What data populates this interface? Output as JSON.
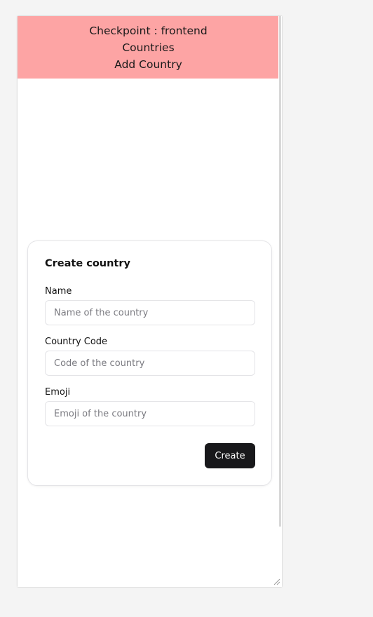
{
  "header": {
    "line1": "Checkpoint : frontend",
    "line2": "Countries",
    "line3": "Add Country",
    "background": "#fda4a4"
  },
  "form": {
    "title": "Create country",
    "fields": [
      {
        "label": "Name",
        "value": "",
        "placeholder": "Name of the country"
      },
      {
        "label": "Country Code",
        "value": "",
        "placeholder": "Code of the country"
      },
      {
        "label": "Emoji",
        "value": "",
        "placeholder": "Emoji of the country"
      }
    ],
    "submit_label": "Create",
    "submit_color": "#18181b"
  }
}
